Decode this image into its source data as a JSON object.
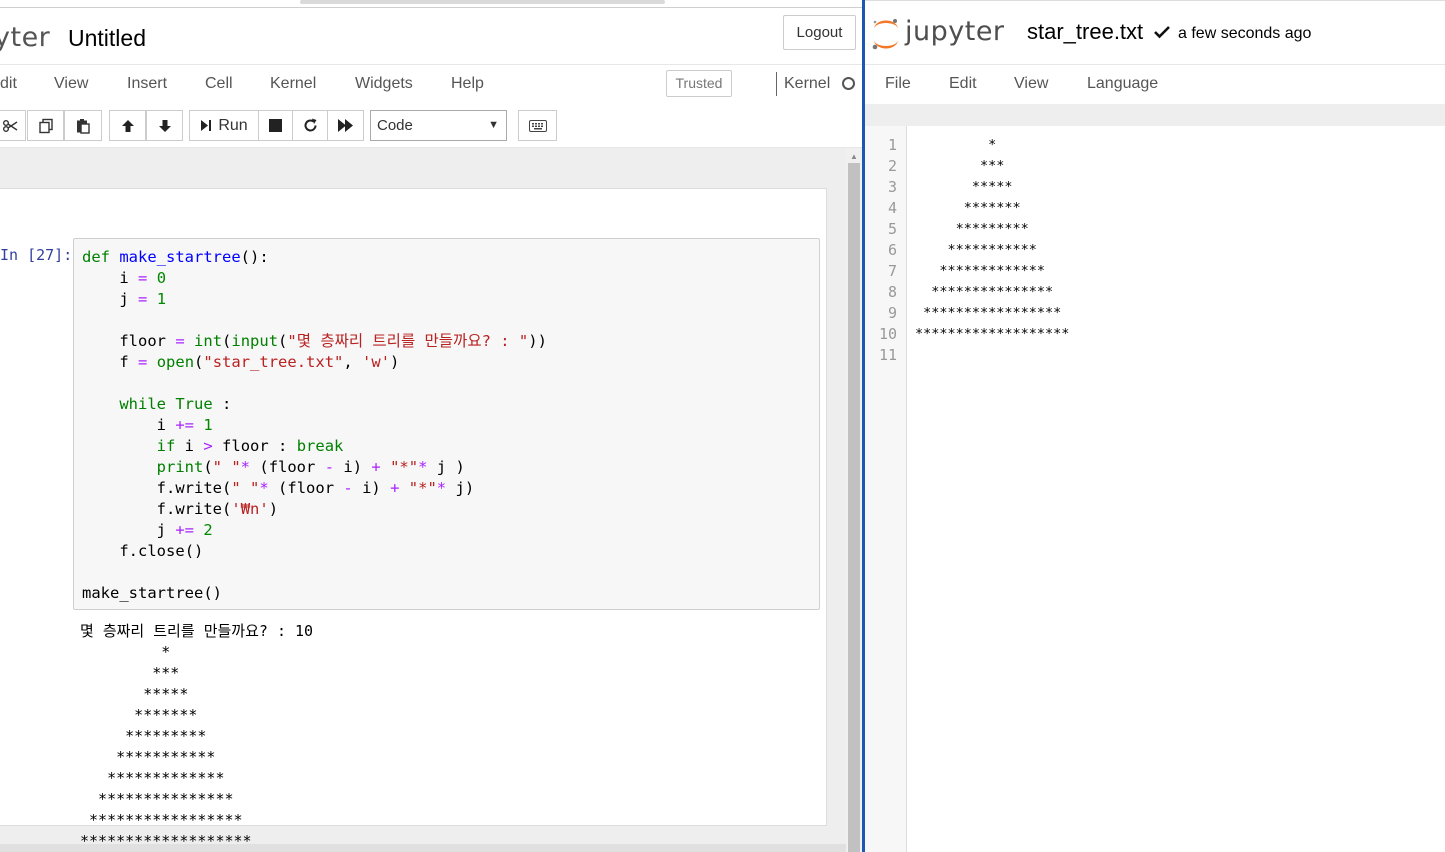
{
  "notebook": {
    "logo_text": "yter",
    "title": "Untitled",
    "logout_label": "Logout",
    "menu": [
      "dit",
      "View",
      "Insert",
      "Cell",
      "Kernel",
      "Widgets",
      "Help"
    ],
    "trusted_label": "Trusted",
    "kernel_label": "Kernel",
    "toolbar": {
      "run_label": "Run",
      "cell_type": "Code"
    },
    "cell": {
      "prompt": "In [27]:",
      "code_lines": [
        "def make_startree():",
        "    i = 0",
        "    j = 1",
        "",
        "    floor = int(input(\"몇 층짜리 트리를 만들까요? : \"))",
        "    f = open(\"star_tree.txt\", 'w')",
        "",
        "    while True :",
        "        i += 1",
        "        if i > floor : break",
        "        print(\" \"* (floor - i) + \"*\"* j )",
        "        f.write(\" \"* (floor - i) + \"*\"* j)",
        "        f.write('₩n')",
        "        j += 2",
        "    f.close()",
        "",
        "make_startree()"
      ],
      "output": "몇 층짜리 트리를 만들까요? : 10\n         *\n        ***\n       *****\n      *******\n     *********\n    ***********\n   *************\n  ***************\n *****************\n*******************"
    }
  },
  "editor": {
    "logo_text": "jupyter",
    "filename": "star_tree.txt",
    "saved_status": "a few seconds ago",
    "menu": [
      "File",
      "Edit",
      "View",
      "Language"
    ],
    "line_numbers": "1\n2\n3\n4\n5\n6\n7\n8\n9\n10\n11",
    "content": "         *\n        ***\n       *****\n      *******\n     *********\n    ***********\n   *************\n  ***************\n *****************\n*******************"
  },
  "colors": {
    "jupyter_orange": "#f37726",
    "divider_blue": "#1e56b3",
    "prompt_blue": "#303f9f",
    "keyword_green": "#008000",
    "string_red": "#ba2121",
    "operator_purple": "#aa22ff"
  }
}
